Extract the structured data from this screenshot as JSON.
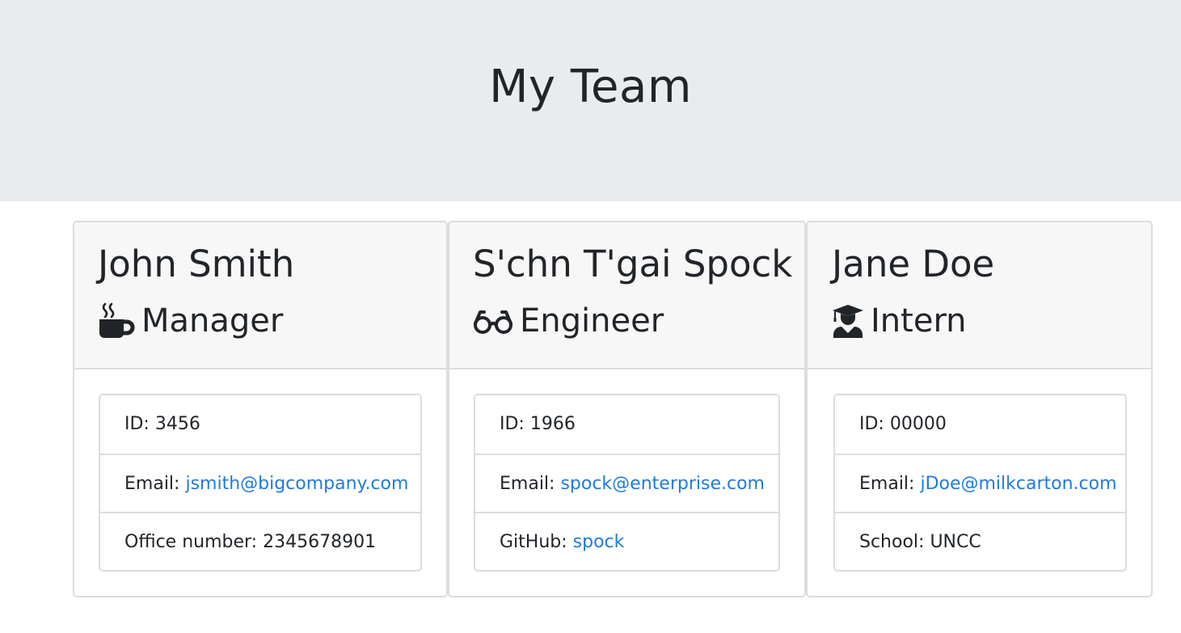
{
  "header": {
    "title": "My Team"
  },
  "employees": [
    {
      "name": "John Smith",
      "role": "Manager",
      "icon": "coffee-mug-icon",
      "id_label": "ID: ",
      "id": "3456",
      "email_label": "Email: ",
      "email": "jsmith@bigcompany.com",
      "extra_label": "Office number: ",
      "extra_value": "2345678901"
    },
    {
      "name": "S'chn T'gai Spock",
      "role": "Engineer",
      "icon": "glasses-icon",
      "id_label": "ID: ",
      "id": "1966",
      "email_label": "Email: ",
      "email": "spock@enterprise.com",
      "extra_label": "GitHub: ",
      "extra_value": "spock"
    },
    {
      "name": "Jane Doe",
      "role": "Intern",
      "icon": "graduate-icon",
      "id_label": "ID: ",
      "id": "00000",
      "email_label": "Email: ",
      "email": "jDoe@milkcarton.com",
      "extra_label": "School: ",
      "extra_value": "UNCC"
    }
  ]
}
